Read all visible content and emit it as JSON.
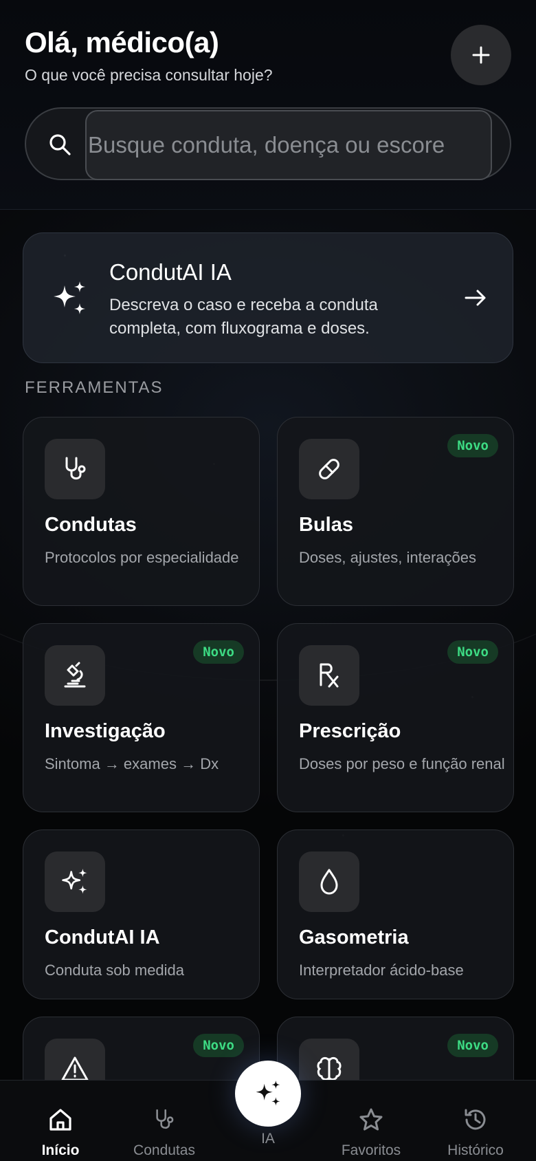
{
  "header": {
    "title": "Olá, médico(a)",
    "subtitle": "O que você precisa consultar hoje?",
    "add_icon": "plus-icon"
  },
  "search": {
    "placeholder": "Busque conduta, doença ou escore",
    "value": ""
  },
  "ai_banner": {
    "title": "CondutAI IA",
    "description": "Descreva o caso e receba a conduta completa, com fluxograma e doses.",
    "icon": "sparkles-icon"
  },
  "section_label": "FERRAMENTAS",
  "tools": [
    {
      "title": "Condutas",
      "desc": "Protocolos por especialidade",
      "badge": "",
      "icon": "stethoscope-icon"
    },
    {
      "title": "Bulas",
      "desc": "Doses, ajustes, interações",
      "badge": "Novo",
      "icon": "pill-icon"
    },
    {
      "title": "Investigação",
      "desc": "Sintoma → exames → Dx",
      "badge": "Novo",
      "icon": "microscope-icon"
    },
    {
      "title": "Prescrição",
      "desc": "Doses por peso e função renal",
      "badge": "Novo",
      "icon": "rx-icon"
    },
    {
      "title": "CondutAI IA",
      "desc": "Conduta sob medida",
      "badge": "",
      "icon": "sparkles-icon"
    },
    {
      "title": "Gasometria",
      "desc": "Interpretador ácido-base",
      "badge": "",
      "icon": "droplet-icon"
    },
    {
      "title": "",
      "desc": "",
      "badge": "Novo",
      "icon": "warning-icon"
    },
    {
      "title": "",
      "desc": "",
      "badge": "Novo",
      "icon": "brain-icon"
    }
  ],
  "nav": {
    "items": [
      {
        "label": "Início",
        "icon": "home-icon",
        "active": true
      },
      {
        "label": "Condutas",
        "icon": "stethoscope-icon",
        "active": false
      },
      {
        "label": "IA",
        "icon": "sparkles-icon",
        "active": false
      },
      {
        "label": "Favoritos",
        "icon": "star-icon",
        "active": false
      },
      {
        "label": "Histórico",
        "icon": "history-icon",
        "active": false
      }
    ]
  },
  "colors": {
    "background": "#060708",
    "card": "#14161a",
    "badge_bg": "#163a25",
    "badge_text": "#3ddc84",
    "muted_text": "#a3a6ab"
  }
}
